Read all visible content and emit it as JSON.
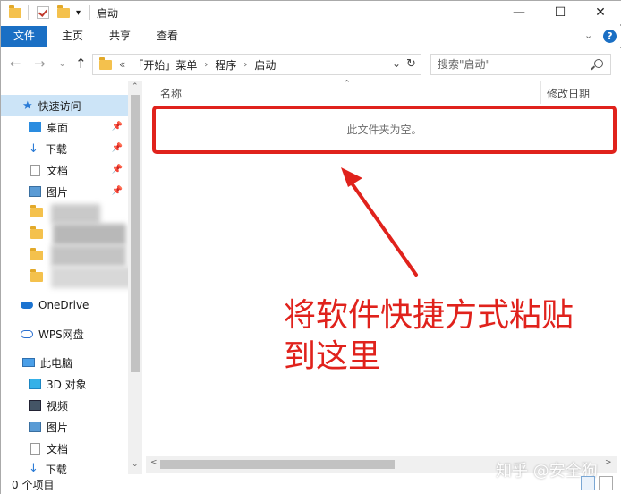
{
  "window": {
    "title": "启动",
    "min_glyph": "—",
    "max_glyph": "☐",
    "close_glyph": "✕"
  },
  "ribbon": {
    "tabs": [
      "文件",
      "主页",
      "共享",
      "查看"
    ],
    "collapse_glyph": "⌄",
    "help_glyph": "?",
    "accent": "#1a6fc4"
  },
  "nav": {
    "back_glyph": "←",
    "forward_glyph": "→",
    "recent_glyph": "⌄",
    "up_glyph": "↑",
    "overflow_glyph": "«",
    "breadcrumb": [
      "「开始」菜单",
      "程序",
      "启动"
    ],
    "dropdown_glyph": "⌄",
    "refresh_glyph": "↻",
    "search_placeholder": "搜索\"启动\""
  },
  "sidebar": {
    "quick_access": "快速访问",
    "pinned": [
      "桌面",
      "下载",
      "文档",
      "图片"
    ],
    "onedrive": "OneDrive",
    "wps": "WPS网盘",
    "this_pc": "此电脑",
    "pc_items": [
      "3D 对象",
      "视频",
      "图片",
      "文档",
      "下载"
    ],
    "pin_glyph": "📌"
  },
  "content": {
    "sort_glyph": "⌃",
    "columns": [
      "名称",
      "修改日期"
    ],
    "empty_message": "此文件夹为空。",
    "annotation_line1": "将软件快捷方式粘贴",
    "annotation_line2": "到这里",
    "annotation_color": "#e0221c"
  },
  "scroll": {
    "up_glyph": "⌃",
    "down_glyph": "⌄",
    "left_glyph": "<",
    "right_glyph": ">"
  },
  "status": {
    "item_count": "0 个项目",
    "watermark": "知乎 @安全狗"
  }
}
